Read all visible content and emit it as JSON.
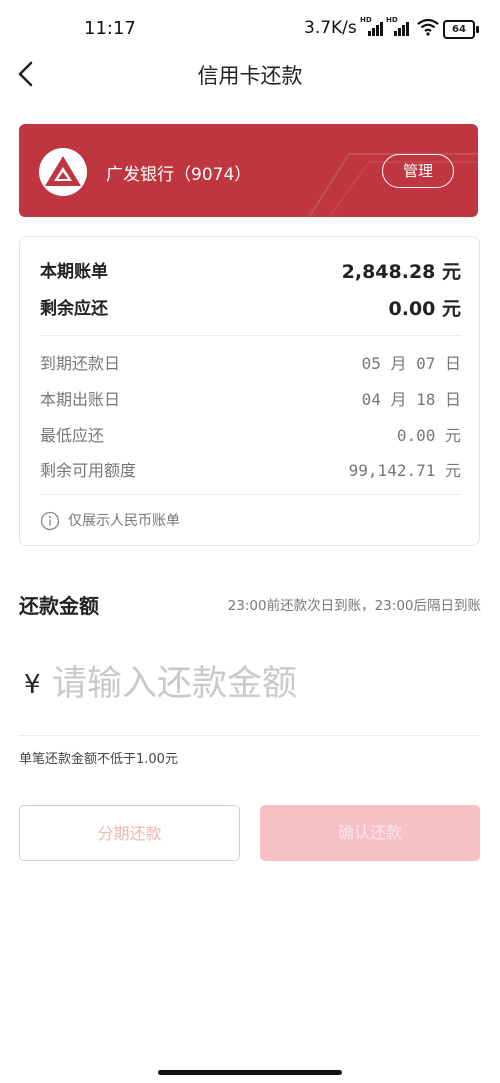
{
  "status_bar": {
    "time": "11:17",
    "net_speed": "3.7K/s",
    "signal_label": "HD",
    "battery": "64"
  },
  "header": {
    "title": "信用卡还款"
  },
  "bank_card": {
    "name": "广发银行（9074）",
    "manage_label": "管理",
    "color": "#bf3640"
  },
  "bill": {
    "current_bill_label": "本期账单",
    "current_bill_value": "2,848.28 元",
    "remaining_label": "剩余应还",
    "remaining_value": "0.00 元",
    "due_date_label": "到期还款日",
    "due_date_value": "05 月 07 日",
    "statement_date_label": "本期出账日",
    "statement_date_value": "04 月 18 日",
    "min_payment_label": "最低应还",
    "min_payment_value": "0.00 元",
    "available_credit_label": "剩余可用额度",
    "available_credit_value": "99,142.71 元",
    "note": "仅展示人民币账单"
  },
  "repayment": {
    "title": "还款金额",
    "hint": "23:00前还款次日到账，23:00后隔日到账",
    "currency_symbol": "¥",
    "amount_placeholder": "请输入还款金额",
    "min_note": "单笔还款金额不低于1.00元"
  },
  "actions": {
    "installment_label": "分期还款",
    "confirm_label": "确认还款"
  }
}
